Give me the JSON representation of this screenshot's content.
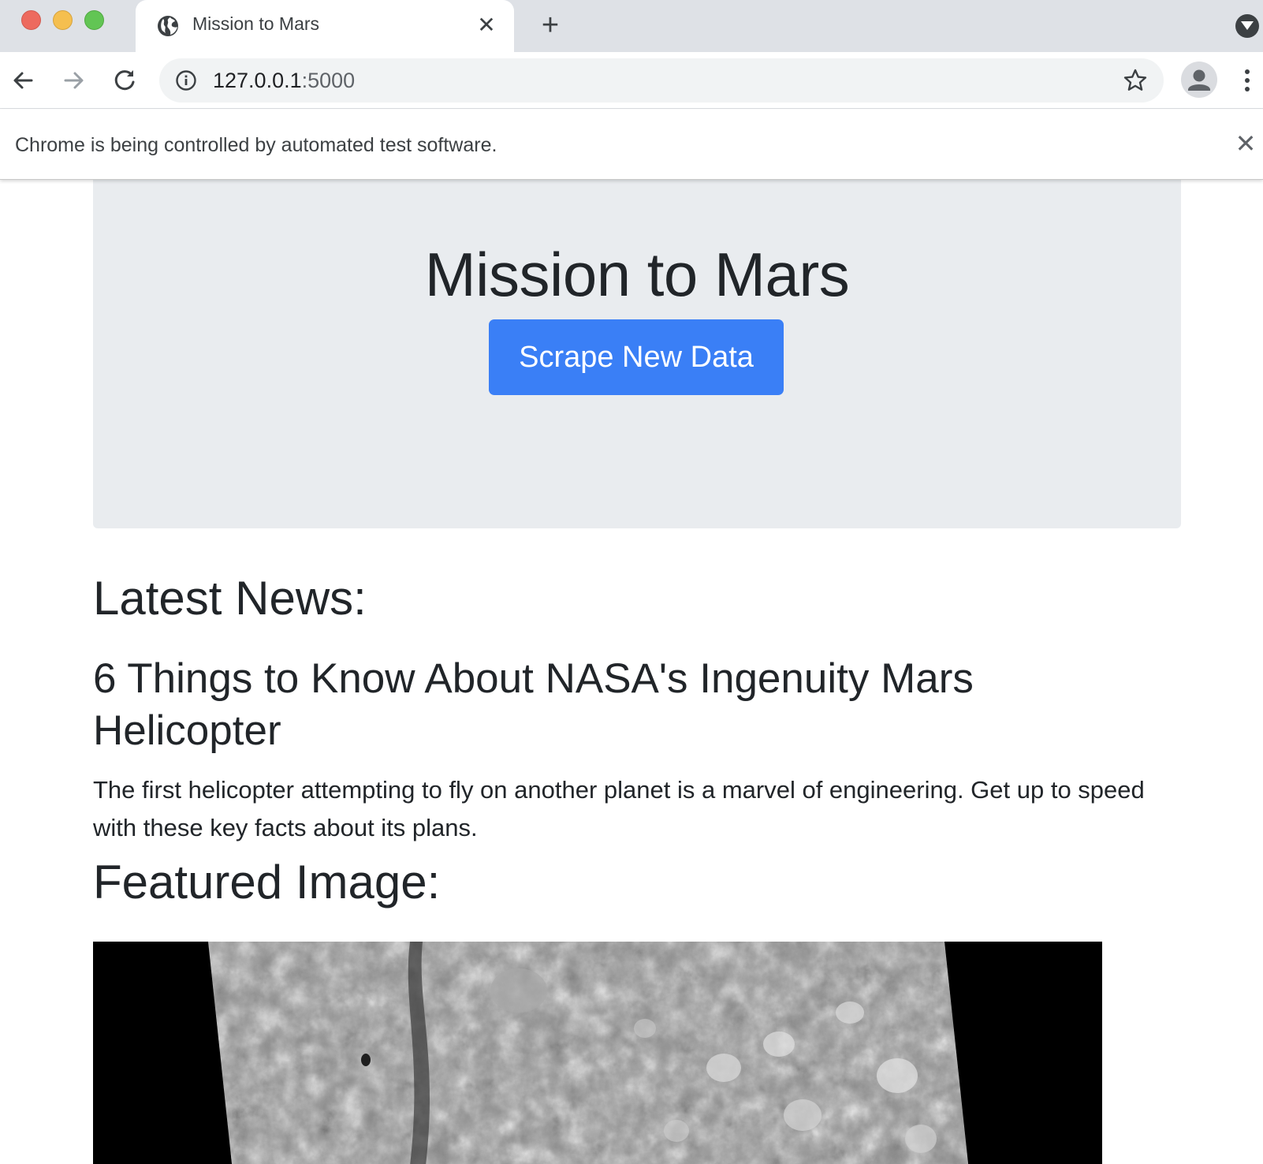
{
  "browser": {
    "tab_title": "Mission to Mars",
    "url_host": "127.0.0.1",
    "url_port": ":5000",
    "infobar_text": "Chrome is being controlled by automated test software."
  },
  "icons": {
    "tab_favicon": "globe-icon",
    "tab_close": "close-icon",
    "new_tab": "plus-icon",
    "tab_search": "chevron-down-icon",
    "back": "arrow-left-icon",
    "forward": "arrow-right-icon",
    "reload": "reload-icon",
    "site_info": "info-icon",
    "bookmark": "star-icon",
    "profile": "avatar-icon",
    "menu": "kebab-menu-icon",
    "infobar_close": "close-icon"
  },
  "jumbotron": {
    "title": "Mission to Mars",
    "button_label": "Scrape New Data"
  },
  "news": {
    "heading": "Latest News:",
    "title": "6 Things to Know About NASA's Ingenuity Mars Helicopter",
    "paragraph": "The first helicopter attempting to fly on another planet is a marvel of engineering. Get up to speed with these key facts about its plans."
  },
  "featured": {
    "heading": "Featured Image:"
  },
  "colors": {
    "button_primary": "#3a7ff6",
    "jumbotron_bg": "#e9ecef",
    "text": "#212529"
  }
}
